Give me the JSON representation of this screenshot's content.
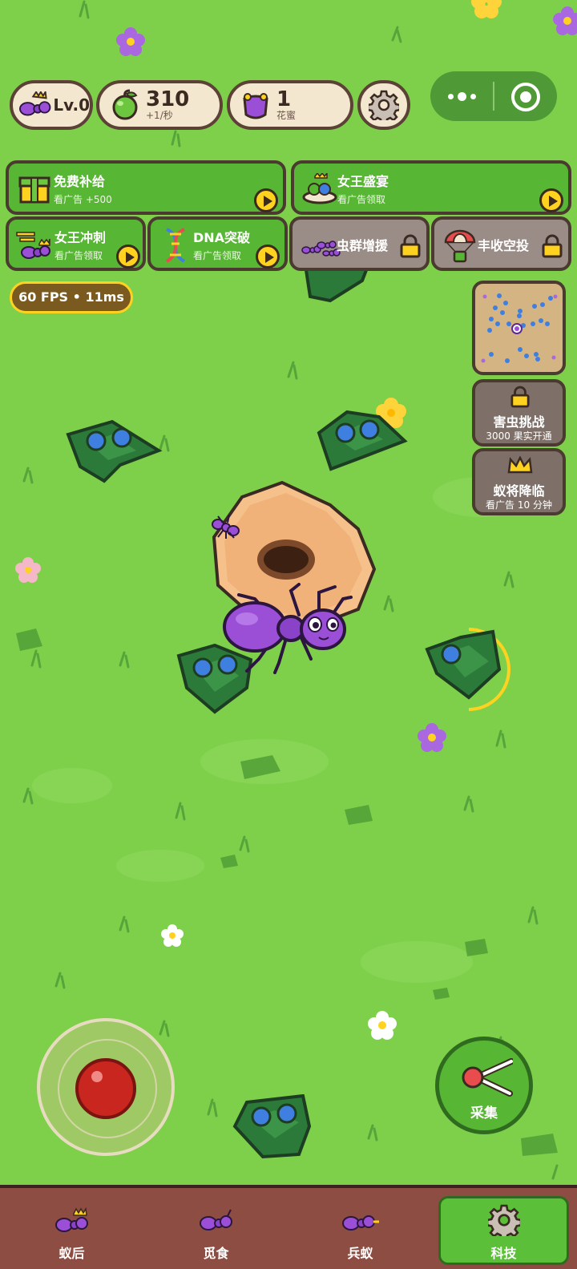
{
  "hud": {
    "level": "Lv.0",
    "fruit_count": "310",
    "fruit_rate": "+1/秒",
    "nectar_count": "1",
    "nectar_label": "花蜜"
  },
  "ads": {
    "free_supply": {
      "title": "免费补给",
      "sub": "看广告 +500"
    },
    "queen_feast": {
      "title": "女王盛宴",
      "sub": "看广告领取"
    },
    "queen_rush": {
      "title": "女王冲刺",
      "sub": "看广告领取"
    },
    "dna_break": {
      "title": "DNA突破",
      "sub": "看广告领取"
    },
    "swarm_reinforce": {
      "title": "虫群增援"
    },
    "harvest_airdrop": {
      "title": "丰收空投"
    }
  },
  "fps": {
    "fps": "60 FPS",
    "sep": "•",
    "ms": "11ms"
  },
  "side": {
    "pest_challenge": {
      "title": "害虫挑战",
      "sub": "3000 果实开通"
    },
    "general_arrive": {
      "title": "蚁将降临",
      "sub": "看广告 10 分钟"
    }
  },
  "collect_label": "采集",
  "nav": [
    {
      "label": "蚁后"
    },
    {
      "label": "觅食"
    },
    {
      "label": "兵蚁"
    },
    {
      "label": "科技"
    }
  ],
  "colors": {
    "grass": "#7ed04b",
    "button_green": "#58b635",
    "locked_gray": "#9a8c86",
    "nav_brown": "#8e4d42",
    "ant_purple": "#9b4fd6",
    "berry_blue": "#3f7fe0",
    "play_yellow": "#ffd21f"
  },
  "icons": [
    "ant-queen-icon",
    "apple-icon",
    "nectar-pot-icon",
    "gear-icon",
    "more-icon",
    "record-icon",
    "gift-icon",
    "feast-icon",
    "speed-ant-icon",
    "dna-icon",
    "swarm-icon",
    "parachute-icon",
    "lock-icon",
    "crown-icon",
    "scissors-icon"
  ]
}
